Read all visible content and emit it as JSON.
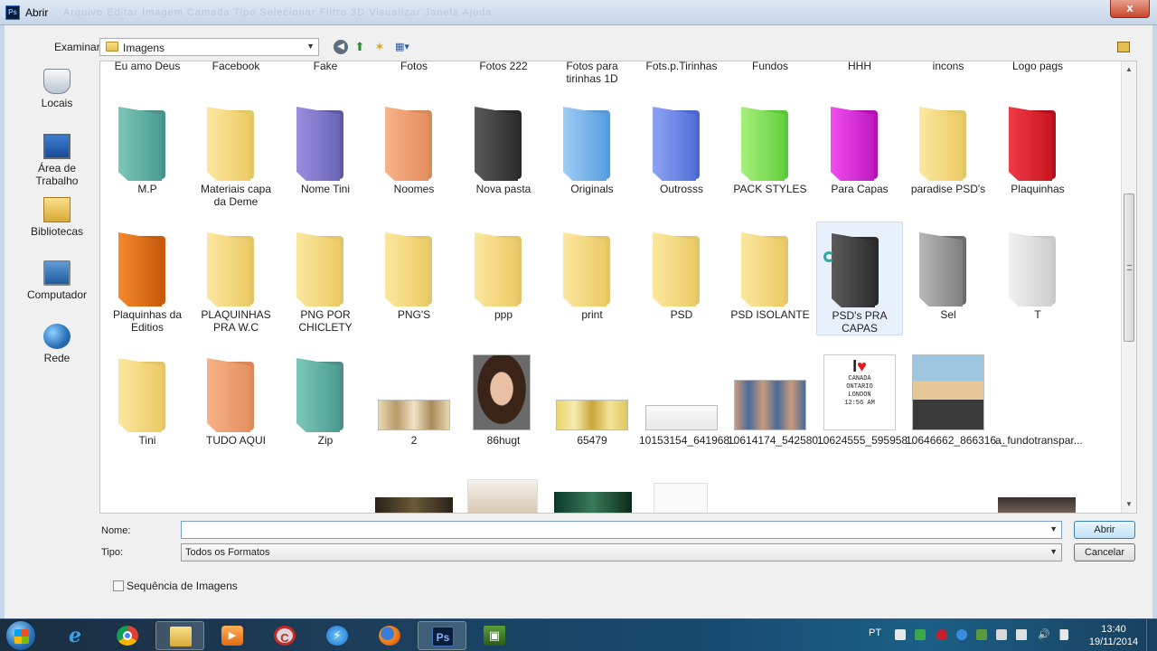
{
  "window": {
    "title": "Abrir",
    "app_icon_text": "Ps",
    "close_symbol": "x",
    "ghost_menu": "Arquivo   Editar   Imagem   Camada   Tipo   Selecionar   Filtro   3D   Visualizar   Janela   Ajuda"
  },
  "toolbar": {
    "lookin_label": "Examinar:",
    "lookin_value": "Imagens"
  },
  "places": [
    {
      "label": "Locais",
      "icon": "recent-places-icon"
    },
    {
      "label": "Área de Trabalho",
      "icon": "desktop-icon"
    },
    {
      "label": "Bibliotecas",
      "icon": "libraries-icon"
    },
    {
      "label": "Computador",
      "icon": "computer-icon"
    },
    {
      "label": "Rede",
      "icon": "network-icon"
    }
  ],
  "files": {
    "row0": [
      "Eu amo Deus",
      "Facebook",
      "Fake",
      "Fotos",
      "Fotos 222",
      "Fotos para tirinhas 1D",
      "Fots.p.Tirinhas",
      "Fundos",
      "HHH",
      "incons",
      "Logo pags"
    ],
    "row1": [
      "M.P",
      "Materiais capa da Deme",
      "Nome Tini",
      "Noomes",
      "Nova pasta",
      "Originals",
      "Outrosss",
      "PACK STYLES",
      "Para Capas",
      "paradise PSD's",
      "Plaquinhas"
    ],
    "row2": [
      "Plaquinhas da Editios",
      "PLAQUINHAS PRA W.C",
      "PNG POR CHICLETY",
      "PNG'S",
      "ppp",
      "print",
      "PSD",
      "PSD ISOLANTE",
      "PSD's PRA CAPAS",
      "Sel",
      "T"
    ],
    "row3": [
      "Tini",
      "TUDO AQUI",
      "Zip",
      "2",
      "86hugt",
      "65479",
      "10153154_641968...",
      "10614174_542580...",
      "10624555_595958...",
      "10646662_866316...",
      "a_fundotranspar..."
    ]
  },
  "thumb_text": {
    "i_love": "I",
    "poster_lines": [
      "CANADA",
      "ONTARIO",
      "LONDON",
      "12:56 AM"
    ]
  },
  "bottom": {
    "name_label": "Nome:",
    "name_value": "",
    "type_label": "Tipo:",
    "type_value": "Todos os Formatos",
    "open_button": "Abrir",
    "cancel_button": "Cancelar",
    "sequence_checkbox": "Sequência de Imagens",
    "sequence_checked": false
  },
  "taskbar": {
    "lang": "PT",
    "time": "13:40",
    "date": "19/11/2014",
    "apps": [
      "internet-explorer-icon",
      "chrome-icon",
      "file-explorer-icon",
      "media-player-icon",
      "ccleaner-icon",
      "flash-icon",
      "firefox-icon",
      "photoshop-icon",
      "camtasia-icon"
    ],
    "active_app": "photoshop-icon"
  },
  "colors": {
    "accent": "#3c7fb1",
    "selection_bg": "#e8f1fb"
  }
}
